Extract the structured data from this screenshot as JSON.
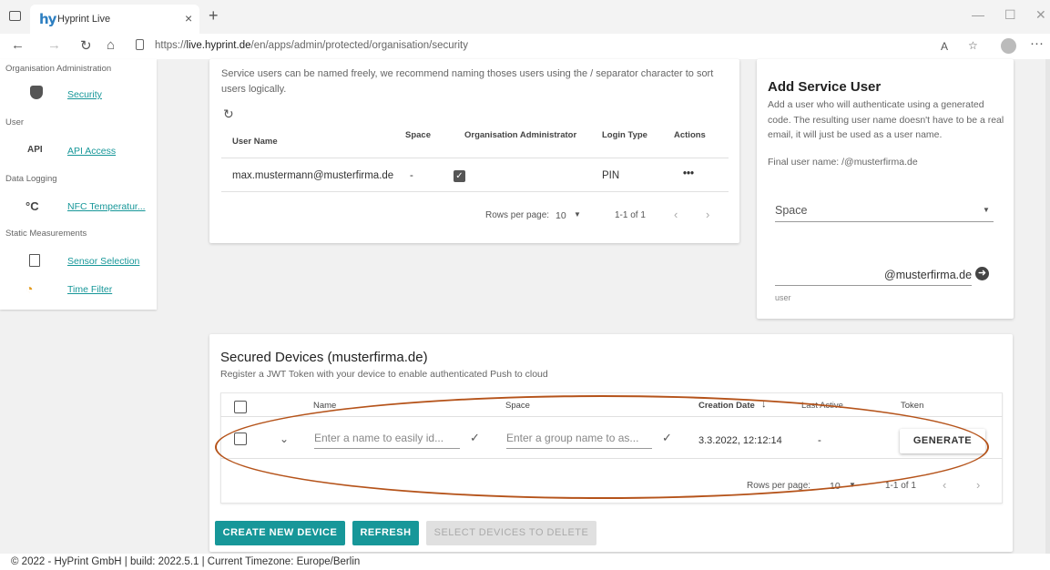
{
  "browser": {
    "tab_title": "Hyprint Live",
    "tab_logo": "hy",
    "url_prefix": "https://",
    "url_host": "live.hyprint.de",
    "url_path": "/en/apps/admin/protected/organisation/security",
    "icons": [
      "back-icon",
      "forward-icon",
      "reload-icon",
      "home-icon",
      "lock-icon",
      "read-aloud-icon",
      "favorites-icon",
      "profile-avatar",
      "more-icon"
    ]
  },
  "sidebar": {
    "sections": [
      {
        "heading": "Organisation Administration",
        "items": [
          {
            "icon": "shield-icon",
            "label": "Security"
          }
        ]
      },
      {
        "heading": "User",
        "items": [
          {
            "icon": "api-icon",
            "icon_text": "API",
            "label": "API Access"
          }
        ]
      },
      {
        "heading": "Data Logging",
        "items": [
          {
            "icon": "temperature-icon",
            "icon_text": "°C",
            "label": "NFC Temperatur..."
          }
        ]
      },
      {
        "heading": "Static Measurements",
        "items": [
          {
            "icon": "document-icon",
            "label": "Sensor Selection"
          },
          {
            "icon": "time-filter-icon",
            "label": "Time Filter"
          }
        ]
      }
    ]
  },
  "service_users": {
    "description": "Service users can be named freely, we recommend naming thoses users using the / separator character to sort users logically.",
    "columns": [
      "User Name",
      "Space",
      "Organisation Administrator",
      "Login Type",
      "Actions"
    ],
    "rows": [
      {
        "user_name": "max.mustermann@musterfirma.de",
        "space": "-",
        "org_admin": true,
        "login_type": "PIN",
        "actions": "•••"
      }
    ],
    "rows_per_page_label": "Rows per page:",
    "rows_per_page": "10",
    "range": "1-1 of 1"
  },
  "add_service_user": {
    "title": "Add Service User",
    "description": "Add a user who will authenticate using a generated code. The resulting user name doesn't have to be a real email, it will just be used as a user name.",
    "final_user_name": "Final user name: /@musterfirma.de",
    "space_label": "Space",
    "domain_suffix": "@musterfirma.de",
    "user_label": "user"
  },
  "secured_devices": {
    "title": "Secured Devices (musterfirma.de)",
    "subtitle": "Register a JWT Token with your device to enable authenticated Push to cloud",
    "columns": [
      "Name",
      "Space",
      "Creation Date",
      "Last Active",
      "Token"
    ],
    "sort_indicator": "↓",
    "row": {
      "name_placeholder": "Enter a name to easily id...",
      "space_placeholder": "Enter a group name to as...",
      "creation_date": "3.3.2022, 12:12:14",
      "last_active": "-",
      "token_button": "GENERATE"
    },
    "rows_per_page_label": "Rows per page:",
    "rows_per_page": "10",
    "range": "1-1 of 1",
    "buttons": {
      "create": "CREATE NEW DEVICE",
      "refresh": "REFRESH",
      "delete": "SELECT DEVICES TO DELETE"
    }
  },
  "footer": {
    "text": "© 2022 - HyPrint GmbH | build: 2022.5.1 | Current Timezone: Europe/Berlin"
  },
  "colors": {
    "accent": "#179799",
    "annotation": "#b5531a"
  }
}
